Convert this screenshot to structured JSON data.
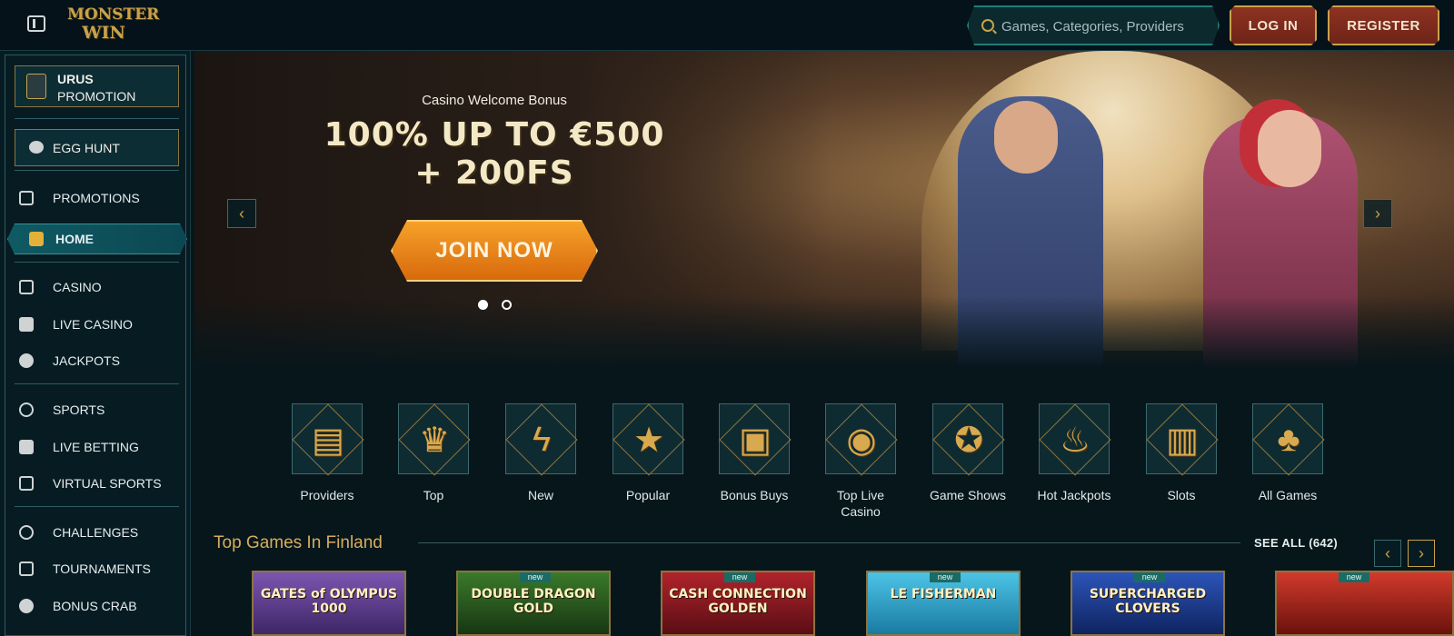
{
  "header": {
    "logo": {
      "line1": "MONSTER",
      "line2": "WIN"
    },
    "search": {
      "placeholder": "Games, Categories, Providers"
    },
    "login_label": "LOG IN",
    "register_label": "REGISTER"
  },
  "sidebar": {
    "promo_urus": {
      "title": "URUS",
      "subtitle": "PROMOTION"
    },
    "promo_egg": {
      "label": "EGG HUNT"
    },
    "items": [
      {
        "label": "PROMOTIONS",
        "icon": "gift-icon"
      },
      {
        "label": "HOME",
        "icon": "home-icon"
      },
      {
        "label": "CASINO",
        "icon": "slot-machine-icon"
      },
      {
        "label": "LIVE CASINO",
        "icon": "cards-icon"
      },
      {
        "label": "JACKPOTS",
        "icon": "clover-icon"
      },
      {
        "label": "SPORTS",
        "icon": "basketball-icon"
      },
      {
        "label": "LIVE BETTING",
        "icon": "live-icon"
      },
      {
        "label": "VIRTUAL SPORTS",
        "icon": "virtual-icon"
      },
      {
        "label": "CHALLENGES",
        "icon": "badge-icon"
      },
      {
        "label": "TOURNAMENTS",
        "icon": "trophy-icon"
      },
      {
        "label": "BONUS CRAB",
        "icon": "crab-icon"
      }
    ]
  },
  "banner": {
    "subtitle": "Casino Welcome Bonus",
    "title_line1": "100% UP TO €500",
    "title_line2": "+ 200FS",
    "cta_label": "JOIN NOW",
    "slides": 2,
    "active_slide": 1
  },
  "categories": [
    {
      "label": "Providers",
      "icon": "book-icon"
    },
    {
      "label": "Top",
      "icon": "crown-icon"
    },
    {
      "label": "New",
      "icon": "lightning-icon"
    },
    {
      "label": "Popular",
      "icon": "star-icon"
    },
    {
      "label": "Bonus Buys",
      "icon": "chest-icon"
    },
    {
      "label": "Top Live Casino",
      "icon": "chip-icon"
    },
    {
      "label": "Game Shows",
      "icon": "wheel-icon"
    },
    {
      "label": "Hot Jackpots",
      "icon": "flame-icon"
    },
    {
      "label": "Slots",
      "icon": "slot-machine-icon"
    },
    {
      "label": "All Games",
      "icon": "cherries-icon"
    }
  ],
  "top_games": {
    "title": "Top Games In Finland",
    "see_all_label": "SEE ALL (642)",
    "games": [
      {
        "name": "GATES of OLYMPUS 1000",
        "badge": "",
        "color": "#5b3c8a"
      },
      {
        "name": "DOUBLE DRAGON GOLD",
        "badge": "new",
        "color": "#2b5a1f"
      },
      {
        "name": "CASH CONNECTION GOLDEN",
        "badge": "new",
        "color": "#8a1c24"
      },
      {
        "name": "LE FISHERMAN",
        "badge": "new",
        "color": "#2aa3c8"
      },
      {
        "name": "SUPERCHARGED CLOVERS",
        "badge": "new",
        "color": "#1a3a8a"
      },
      {
        "name": "",
        "badge": "new",
        "color": "#b0241c"
      }
    ]
  },
  "colors": {
    "accent_gold": "#c8a24a",
    "teal": "#0f5a63",
    "cta_orange": "#e88317",
    "button_red": "#8e3222"
  }
}
